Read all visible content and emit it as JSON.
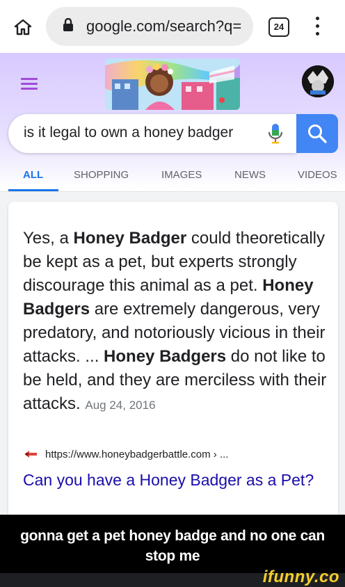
{
  "browser": {
    "url": "google.com/search?q=",
    "tab_count": "24"
  },
  "search": {
    "query": "is it legal to own a honey badger"
  },
  "tabs": [
    {
      "label": "ALL",
      "active": true
    },
    {
      "label": "SHOPPING",
      "active": false
    },
    {
      "label": "IMAGES",
      "active": false
    },
    {
      "label": "NEWS",
      "active": false
    },
    {
      "label": "VIDEOS",
      "active": false
    }
  ],
  "result": {
    "snippet_parts": [
      {
        "text": "Yes, a ",
        "bold": false
      },
      {
        "text": "Honey Badger",
        "bold": true
      },
      {
        "text": " could theoretically be kept as a pet, but experts strongly discourage this animal as a pet. ",
        "bold": false
      },
      {
        "text": "Honey Badgers",
        "bold": true
      },
      {
        "text": " are extremely dangerous, very predatory, and notoriously vicious in their attacks. ... ",
        "bold": false
      },
      {
        "text": "Honey Badgers",
        "bold": true
      },
      {
        "text": " do not like to be held, and they are merciless with their attacks.",
        "bold": false
      }
    ],
    "date": "Aug 24, 2016",
    "source_url": "https://www.honeybadgerbattle.com › ...",
    "title": "Can you have a Honey Badger as a Pet?"
  },
  "caption": "gonna get a pet honey badge and no one can stop me",
  "watermark": "ifunny.co",
  "colors": {
    "link": "#1a0dab",
    "tab_active": "#1a73e8",
    "search_button": "#4285f4",
    "hamburger": "#a14ad8"
  }
}
